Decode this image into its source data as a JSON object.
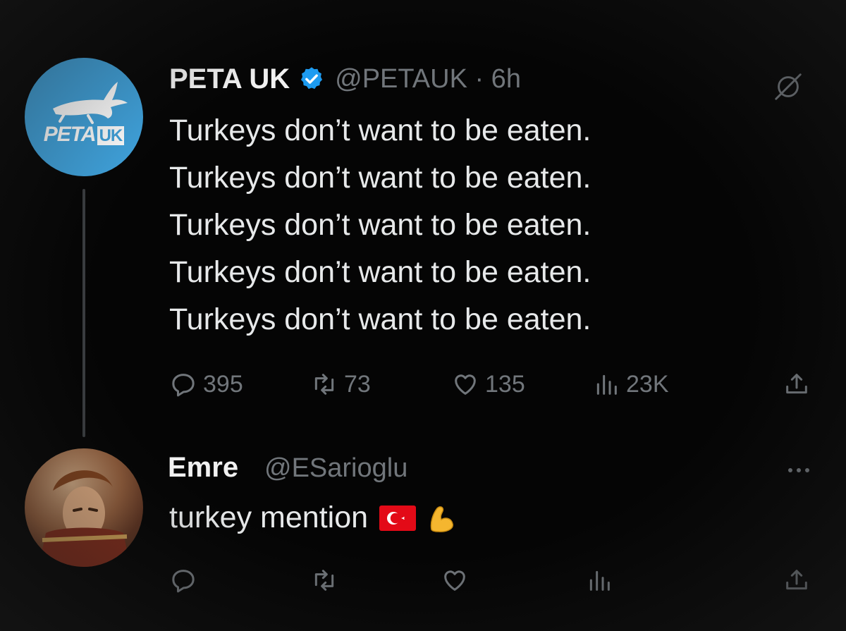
{
  "tweet": {
    "name": "PETA UK",
    "handle_time": "@PETAUK · 6h",
    "logo_text": "PETA",
    "logo_text_suffix": "UK",
    "lines": [
      "Turkeys don’t want to be eaten.",
      "Turkeys don’t want to be eaten.",
      "Turkeys don’t want to be eaten.",
      "Turkeys don’t want to be eaten.",
      "Turkeys don’t want to be eaten."
    ],
    "stats": {
      "replies": "395",
      "reposts": "73",
      "likes": "135",
      "views": "23K"
    }
  },
  "reply": {
    "name": "Emre",
    "handle": "@ESarioglu",
    "text": "turkey mention"
  },
  "icons": {
    "verified": "verified-badge-icon",
    "mute": "mute-icon",
    "reply": "reply-icon",
    "repost": "repost-icon",
    "like": "heart-icon",
    "views": "views-icon",
    "share": "share-icon",
    "more": "more-icon",
    "flag": "turkey-flag-icon",
    "muscle": "flexed-biceps-icon"
  },
  "colors": {
    "background": "#050505",
    "text": "#e7e9ea",
    "muted": "#71767b",
    "verified": "#1d9bf0",
    "peta_blue": "#3fa2dc",
    "flag_red": "#e30a17"
  }
}
